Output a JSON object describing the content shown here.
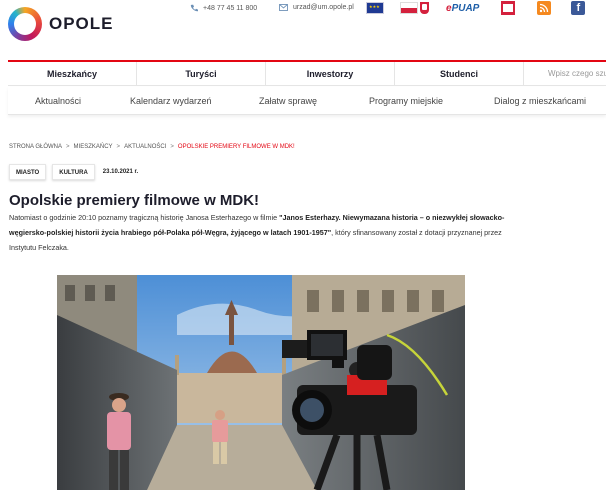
{
  "header": {
    "logo_text": "OPOLE",
    "phone": "+48 77 45 11 800",
    "email": "urzad@um.opole.pl",
    "epuap_label": "PUAP",
    "epuap_prefix": "e",
    "facebook_letter": "f"
  },
  "main_nav": {
    "tabs": [
      {
        "label": "Mieszkańcy",
        "active": true
      },
      {
        "label": "Turyści",
        "active": false
      },
      {
        "label": "Inwestorzy",
        "active": false
      },
      {
        "label": "Studenci",
        "active": false
      }
    ],
    "search_placeholder": "Wpisz czego szukasz"
  },
  "sub_nav": {
    "items": [
      "Aktualności",
      "Kalendarz wydarzeń",
      "Załatw sprawę",
      "Programy miejskie",
      "Dialog z mieszkańcami"
    ]
  },
  "breadcrumb": {
    "items": [
      "STRONA GŁÓWNA",
      "MIESZKAŃCY",
      "AKTUALNOŚCI",
      "OPOLSKIE PREMIERY FILMOWE W MDK!"
    ],
    "separator": ">"
  },
  "article": {
    "tags": [
      "MIASTO",
      "KULTURA"
    ],
    "date": "23.10.2021 r.",
    "title": "Opolskie premiery filmowe w MDK!",
    "lead_part1": "Natomiast o godzinie 20:10 poznamy tragiczną historię Janosa Esterhazego w filmie ",
    "lead_bold": "\"Janos Esterhazy. Niewymazana historia – o niezwykłej słowacko-węgiersko-polskiej historii życia hrabiego pół-Polaka pół-Węgra, żyjącego w latach 1901-1957\"",
    "lead_part2": ", który sfinansowany został z dotacji przyznanej przez Instytutu Felczaka."
  },
  "colors": {
    "accent": "#e30613",
    "text_dark": "#1d1d2b"
  }
}
